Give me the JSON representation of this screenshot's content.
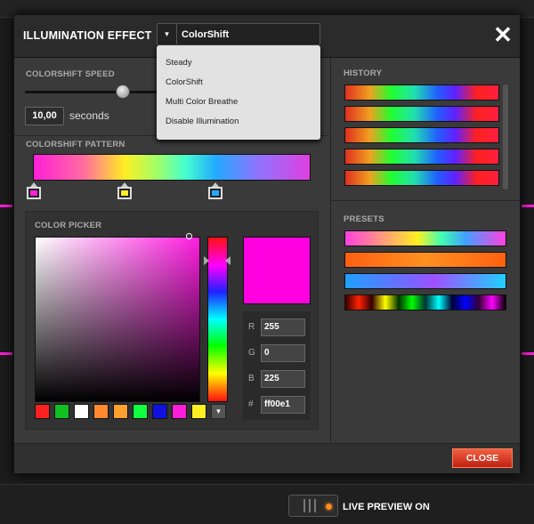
{
  "header": {
    "title": "ILLUMINATION EFFECT",
    "mode_value": "ColorShift"
  },
  "mode_dropdown": {
    "options": [
      "Steady",
      "ColorShift",
      "Multi Color Breathe",
      "Disable Illumination"
    ]
  },
  "speed": {
    "label": "COLORSHIFT SPEED",
    "value": "10,00",
    "unit": "seconds"
  },
  "pattern": {
    "label": "COLORSHIFT PATTERN",
    "stops": [
      {
        "color": "#ff1ed8"
      },
      {
        "color": "#ffee22"
      },
      {
        "color": "#22aaff"
      }
    ]
  },
  "color_picker": {
    "label": "COLOR PICKER",
    "current_color": "#ff00e1",
    "r_label": "R",
    "r": "255",
    "g_label": "G",
    "g": "0",
    "b_label": "B",
    "b": "225",
    "hex_label": "#",
    "hex": "ff00e1",
    "swatches": [
      "#ff2020",
      "#10c020",
      "#ffffff",
      "#ff8a30",
      "#ffa030",
      "#10ff40",
      "#1010e0",
      "#ff1ed8",
      "#ffee22"
    ]
  },
  "history": {
    "label": "HISTORY"
  },
  "presets": {
    "label": "PRESETS",
    "gradients": [
      "linear-gradient(90deg,#ff40e0,#ffee22 45%,#40ffb0 60%,#40a0ff 75%,#ff40e0)",
      "linear-gradient(90deg,#ff6010,#ff9020 50%,#ff6010)",
      "linear-gradient(90deg,#20a0ff,#8060ff 45%,#a050ff 55%,#20d0ff)",
      "linear-gradient(90deg,#300,#f20,#300,#ff0,#030,#0f0,#033,#0ff,#003,#00f,#303,#f0f,#000)"
    ]
  },
  "footer": {
    "close_label": "CLOSE"
  },
  "live_preview": {
    "label": "LIVE PREVIEW ON"
  }
}
